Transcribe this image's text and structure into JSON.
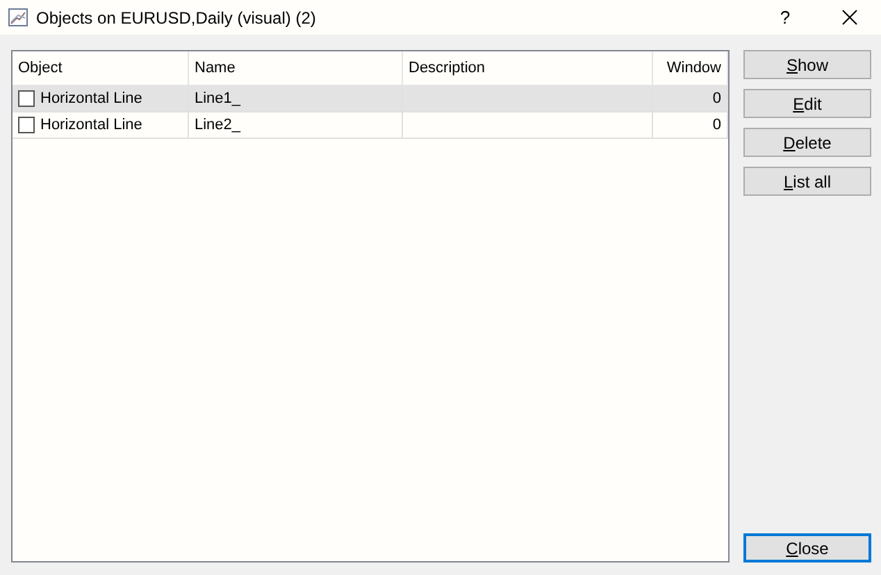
{
  "window": {
    "title": "Objects on EURUSD,Daily (visual) (2)",
    "help": "?"
  },
  "table": {
    "columns": [
      "Object",
      "Name",
      "Description",
      "Window"
    ],
    "rows": [
      {
        "checked": false,
        "selected": true,
        "cells": [
          "Horizontal Line",
          "Line1_",
          "",
          "0"
        ]
      },
      {
        "checked": false,
        "selected": false,
        "cells": [
          "Horizontal Line",
          "Line2_",
          "",
          "0"
        ]
      }
    ]
  },
  "buttons": [
    {
      "mnemonic": "S",
      "rest": "how",
      "focused": false
    },
    {
      "mnemonic": "E",
      "rest": "dit",
      "focused": false
    },
    {
      "mnemonic": "D",
      "rest": "elete",
      "focused": false
    },
    {
      "mnemonic": "L",
      "rest": "ist all",
      "focused": false
    }
  ],
  "close_button": {
    "mnemonic": "C",
    "rest": "lose",
    "focused": true
  }
}
